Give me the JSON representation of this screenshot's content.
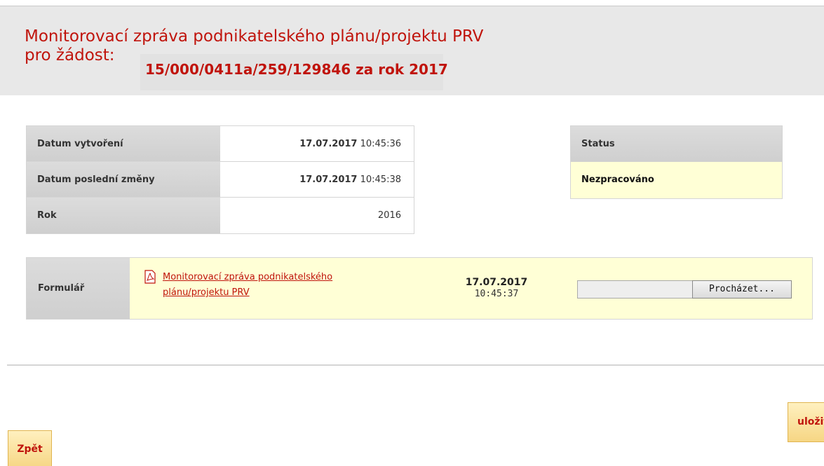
{
  "header": {
    "title_line1": "Monitorovací zpráva podnikatelského plánu/projektu PRV",
    "title_line2_prefix": "pro žádost:",
    "application_id": "15/000/0411a/259/129846 za rok 2017"
  },
  "info": {
    "rows": [
      {
        "label": "Datum vytvoření",
        "date": "17.07.2017",
        "time": "10:45:36"
      },
      {
        "label": "Datum poslední změny",
        "date": "17.07.2017",
        "time": "10:45:38"
      },
      {
        "label": "Rok",
        "value": "2016"
      }
    ]
  },
  "status": {
    "header": "Status",
    "value": "Nezpracováno"
  },
  "form": {
    "label": "Formulář",
    "icon": "pdf-icon",
    "link_text": "Monitorovací zpráva podnikatelského plánu/projektu PRV",
    "date": "17.07.2017",
    "time": "10:45:37",
    "browse_label": "Procházet..."
  },
  "buttons": {
    "save": "uložit",
    "back": "Zpět"
  },
  "colors": {
    "accent_red": "#c0140c",
    "highlight_yellow": "#ffffd6",
    "button_gold": "#f6d684"
  }
}
